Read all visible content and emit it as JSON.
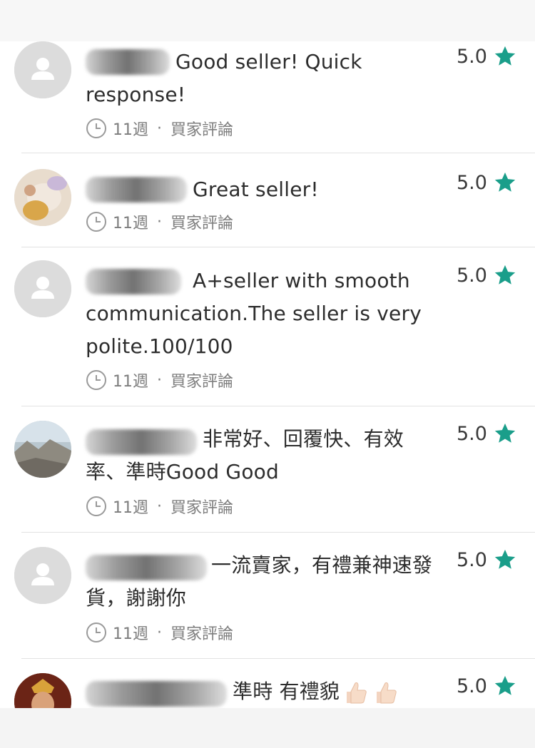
{
  "reviews": [
    {
      "avatar": "default-user-icon",
      "text": "Good seller! Quick response!",
      "time": "11週",
      "separator": "·",
      "source": "買家評論",
      "rating": "5.0"
    },
    {
      "avatar": "photo-avatar",
      "text": "Great seller!",
      "time": "11週",
      "separator": "·",
      "source": "買家評論",
      "rating": "5.0"
    },
    {
      "avatar": "default-user-icon",
      "text": "A+seller with smooth communication.The seller is very polite.100/100",
      "time": "11週",
      "separator": "·",
      "source": "買家評論",
      "rating": "5.0"
    },
    {
      "avatar": "photo-avatar",
      "text": "非常好、回覆快、有效率、準時Good Good",
      "time": "11週",
      "separator": "·",
      "source": "買家評論",
      "rating": "5.0"
    },
    {
      "avatar": "default-user-icon",
      "text": "一流賣家，有禮兼神速發貨，謝謝你",
      "time": "11週",
      "separator": "·",
      "source": "買家評論",
      "rating": "5.0"
    },
    {
      "avatar": "photo-avatar",
      "text": "準時 有禮貌",
      "time": "",
      "separator": "",
      "source": "",
      "rating": "5.0"
    }
  ],
  "colors": {
    "star": "#1a9e8a",
    "avatar_placeholder": "#dcdcdc",
    "divider": "#e2e2e2"
  },
  "icons": {
    "clock": "clock-icon",
    "star": "star-icon",
    "thumbs_up": "thumbs-up-icon",
    "default_avatar": "user-silhouette-icon"
  }
}
